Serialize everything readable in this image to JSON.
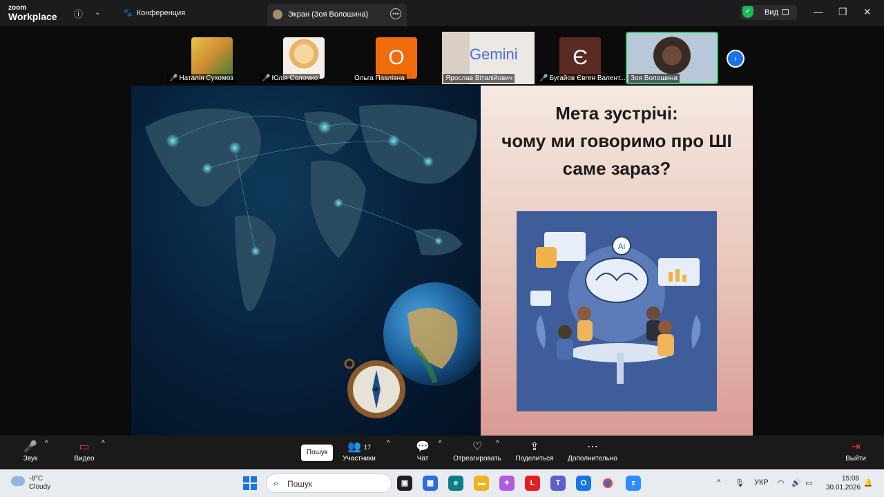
{
  "app": {
    "brand_small": "zoom",
    "brand_big": "Workplace"
  },
  "titlebar": {
    "conference_label": "Конференция",
    "tab_label": "Экран (Зоя Волошина)",
    "view_label": "Вид"
  },
  "participants": [
    {
      "name": "Наталія Сухомоз",
      "muted": true
    },
    {
      "name": "Юлія Соломко",
      "muted": true
    },
    {
      "name": "Ольга Павлівна",
      "muted": false,
      "initial": "О"
    },
    {
      "name": "Ярослав Віталійович",
      "muted": false,
      "overlay_text": "Gemini"
    },
    {
      "name": "Бугайов Євген Валент...",
      "muted": true,
      "initial": "Є"
    },
    {
      "name": "Зоя Волошина",
      "muted": false,
      "active": true
    }
  ],
  "slide": {
    "title_lines": [
      "Мета зустрічі:",
      "чому ми говоримо про ШІ",
      "саме зараз?"
    ],
    "illustration_badge": "Ai"
  },
  "toolbar": {
    "audio": "Звук",
    "video": "Видео",
    "search": "Пошук",
    "participants": "Участники",
    "participants_count": "17",
    "chat": "Чат",
    "react": "Отреагировать",
    "share": "Поделиться",
    "more": "Дополнительно",
    "leave": "Выйти"
  },
  "taskbar": {
    "temperature": "-8°C",
    "weather": "Cloudy",
    "search_placeholder": "Пошук",
    "language": "УКР",
    "time": "15:08",
    "date": "30.01.2026"
  },
  "colors": {
    "accent": "#1a73e8",
    "active_border": "#2ecc71",
    "muted": "#e33333"
  }
}
